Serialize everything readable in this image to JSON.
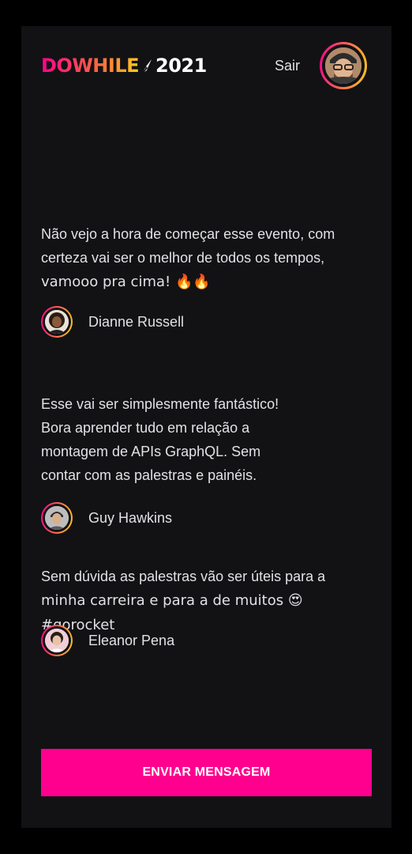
{
  "header": {
    "logo_part1": "DOWHILE",
    "logo_year": "2021",
    "sign_out_label": "Sair",
    "user_avatar_alt": "user-avatar"
  },
  "messages": [
    {
      "lines": [
        "Não vejo a hora de começar esse evento, com",
        "certeza vai ser o melhor de todos os tempos,",
        "vamooo pra cima! 🔥🔥"
      ],
      "author": "Dianne Russell"
    },
    {
      "lines": [
        "Esse vai ser simplesmente fantástico!",
        "Bora aprender tudo em relação a",
        "montagem de APIs GraphQL. Sem",
        "contar com as palestras e painéis."
      ],
      "author": "Guy Hawkins"
    },
    {
      "lines": [
        "Sem dúvida as palestras vão ser úteis para a",
        "minha carreira e para a de muitos 😍 #gorocket"
      ],
      "author": "Eleanor Pena"
    }
  ],
  "send_button_label": "ENVIAR MENSAGEM",
  "colors": {
    "background": "#121214",
    "accent": "#ff008e",
    "gradient_end": "#ffcd1e",
    "text": "#e1e1e6"
  }
}
